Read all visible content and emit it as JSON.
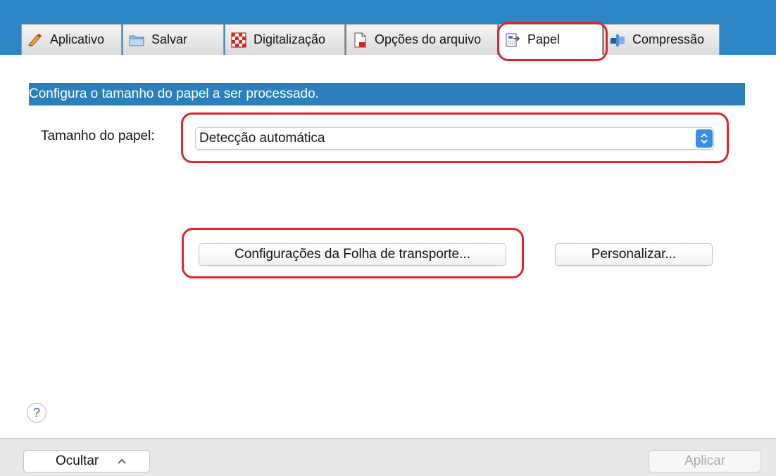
{
  "tabs": [
    {
      "label": "Aplicativo",
      "icon": "pen-icon"
    },
    {
      "label": "Salvar",
      "icon": "folder-icon"
    },
    {
      "label": "Digitalização",
      "icon": "checkerboard-icon"
    },
    {
      "label": "Opções do arquivo",
      "icon": "document-icon"
    },
    {
      "label": "Papel",
      "icon": "paper-icon",
      "active": true
    },
    {
      "label": "Compressão",
      "icon": "compression-icon"
    }
  ],
  "banner": {
    "text": "Configura o tamanho do papel a ser processado."
  },
  "paper_size": {
    "label": "Tamanho do papel:",
    "value": "Detecção automática"
  },
  "buttons": {
    "carrier_sheet": "Configurações da Folha de transporte...",
    "customize": "Personalizar..."
  },
  "help": {
    "glyph": "?"
  },
  "footer": {
    "hide": "Ocultar",
    "apply": "Aplicar"
  },
  "colors": {
    "accent": "#2b7fbb",
    "highlight": "#e0242d"
  }
}
